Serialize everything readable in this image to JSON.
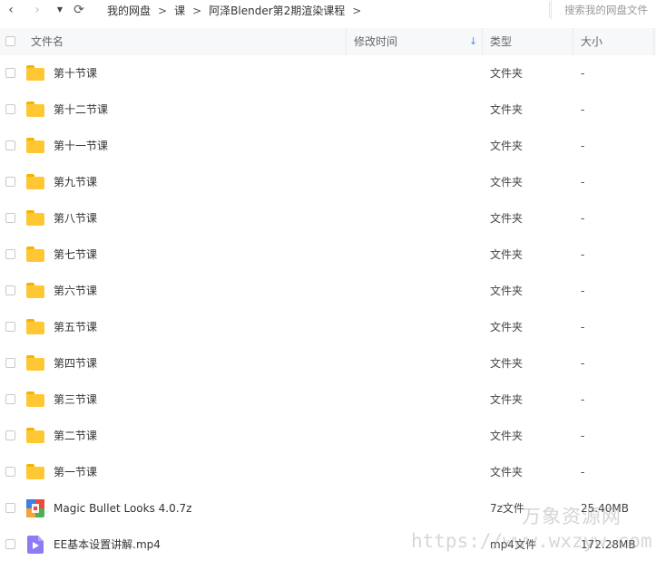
{
  "toolbar": {
    "back_icon": "‹",
    "forward_icon": "›",
    "dropdown_icon": "▼",
    "refresh_icon": "⟳",
    "breadcrumbs": [
      "我的网盘",
      "课",
      "阿泽Blender第2期渲染课程"
    ],
    "separator": ">",
    "search_placeholder": "搜索我的网盘文件"
  },
  "header": {
    "name": "文件名",
    "modified": "修改时间",
    "sort_icon": "↓",
    "type": "类型",
    "size": "大小"
  },
  "files": [
    {
      "name": "第十节课",
      "type": "文件夹",
      "size": "-",
      "icon": "folder-icon"
    },
    {
      "name": "第十二节课",
      "type": "文件夹",
      "size": "-",
      "icon": "folder-icon"
    },
    {
      "name": "第十一节课",
      "type": "文件夹",
      "size": "-",
      "icon": "folder-icon"
    },
    {
      "name": "第九节课",
      "type": "文件夹",
      "size": "-",
      "icon": "folder-icon"
    },
    {
      "name": "第八节课",
      "type": "文件夹",
      "size": "-",
      "icon": "folder-icon"
    },
    {
      "name": "第七节课",
      "type": "文件夹",
      "size": "-",
      "icon": "folder-icon"
    },
    {
      "name": "第六节课",
      "type": "文件夹",
      "size": "-",
      "icon": "folder-icon"
    },
    {
      "name": "第五节课",
      "type": "文件夹",
      "size": "-",
      "icon": "folder-icon"
    },
    {
      "name": "第四节课",
      "type": "文件夹",
      "size": "-",
      "icon": "folder-icon"
    },
    {
      "name": "第三节课",
      "type": "文件夹",
      "size": "-",
      "icon": "folder-icon"
    },
    {
      "name": "第二节课",
      "type": "文件夹",
      "size": "-",
      "icon": "folder-icon"
    },
    {
      "name": "第一节课",
      "type": "文件夹",
      "size": "-",
      "icon": "folder-icon"
    },
    {
      "name": "Magic Bullet Looks 4.0.7z",
      "type": "7z文件",
      "size": "25.40MB",
      "icon": "archive-icon"
    },
    {
      "name": "EE基本设置讲解.mp4",
      "type": "mp4文件",
      "size": "172.28MB",
      "icon": "video-icon"
    }
  ],
  "watermark": {
    "line1": "万象资源网",
    "line2": "https://www.wxzyw.com"
  },
  "colors": {
    "folder": "#ffc733",
    "header_bg": "#f7f8fa",
    "sort_arrow": "#4a8eff",
    "video_icon": "#8b7cf6"
  }
}
